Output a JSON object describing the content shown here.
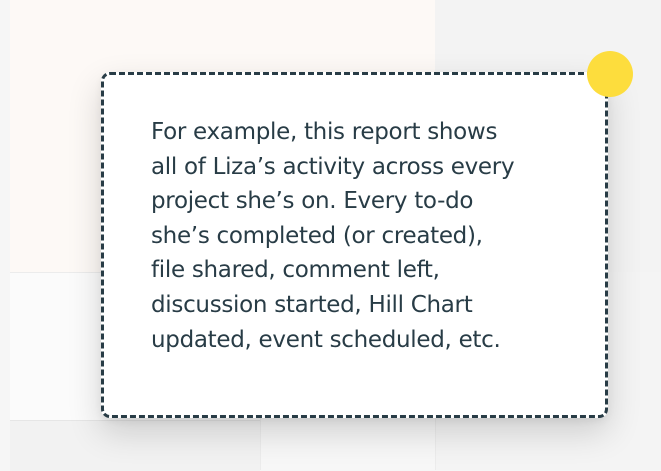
{
  "callout": {
    "text": "For example, this report shows\nall of Liza’s activity across every\nproject she’s on. Every to-do\nshe’s completed (or created),\nfile shared, comment left,\ndiscussion started, Hill Chart\nupdated, event scheduled, etc."
  },
  "marker": {
    "color": "#fddd3d"
  },
  "colors": {
    "text": "#283c46",
    "border": "#283c46",
    "background": "#f6f6f6"
  }
}
